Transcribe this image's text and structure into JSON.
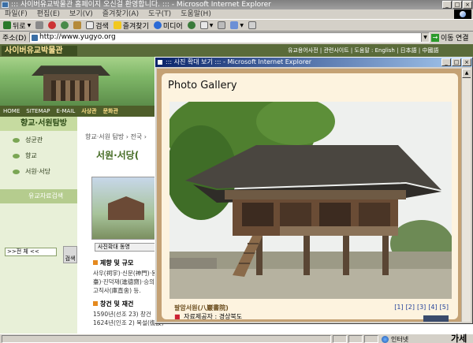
{
  "window": {
    "title": "::: 사이버유교박물관 홈페이지 오신걸 환영합니다. ::: - Microsoft Internet Explorer"
  },
  "menu": [
    "파일(F)",
    "편집(E)",
    "보기(V)",
    "즐겨찾기(A)",
    "도구(T)",
    "도움말(H)"
  ],
  "toolbar": {
    "back": "뒤로",
    "search": "검색",
    "favorites": "즐겨찾기",
    "media": "미디어"
  },
  "address": {
    "label": "주소(D)",
    "url": "http://www.yugyo.org",
    "go": "이동",
    "links": "연결"
  },
  "site": {
    "logo": "사이버유교박물관",
    "util_links": "유교용어사전 | 관련사이트 | 도움말 : English | 日本語 | 中國語",
    "gnb": [
      "HOME",
      "SITEMAP",
      "E-MAIL"
    ],
    "gnb_menu": [
      "사상관",
      "문화관"
    ],
    "lnb_title": "향교·서원탐방",
    "lnb_items": [
      "성균관",
      "향교",
      "서원·서당"
    ],
    "lnb_search_title": "유교자료검색",
    "lnb_select": ">>전    체  <<",
    "lnb_go": "검색",
    "breadcrumb": "향교·서원 탐방 › 전국 ›",
    "section_title": "서원·서당(",
    "thumb_button": "사진확대  동영",
    "sections": [
      {
        "title": "제향 및 규모",
        "lines": [
          "사우(祠宇)·신문(神門)·동",
          "臺)·진덕재(進德齋)·승의",
          "고직사(庫直舍) 등."
        ]
      },
      {
        "title": "창건 및 재건",
        "lines": [
          "1590년(선조 23) 창건",
          "1624년(인조 2) 복설(復設)"
        ]
      }
    ]
  },
  "popup": {
    "title": "::: 사진 확대 보기 ::: - Microsoft Internet Explorer",
    "heading": "Photo Gallery",
    "photo_name": "팔암서원(八巖書院)",
    "source_label": "자료제공자 :",
    "source_value": "경상북도",
    "pages": [
      "[1]",
      "[2]",
      "[3]",
      "[4]",
      "[5]"
    ]
  },
  "status": {
    "zone": "인터넷",
    "ime": "가세"
  }
}
